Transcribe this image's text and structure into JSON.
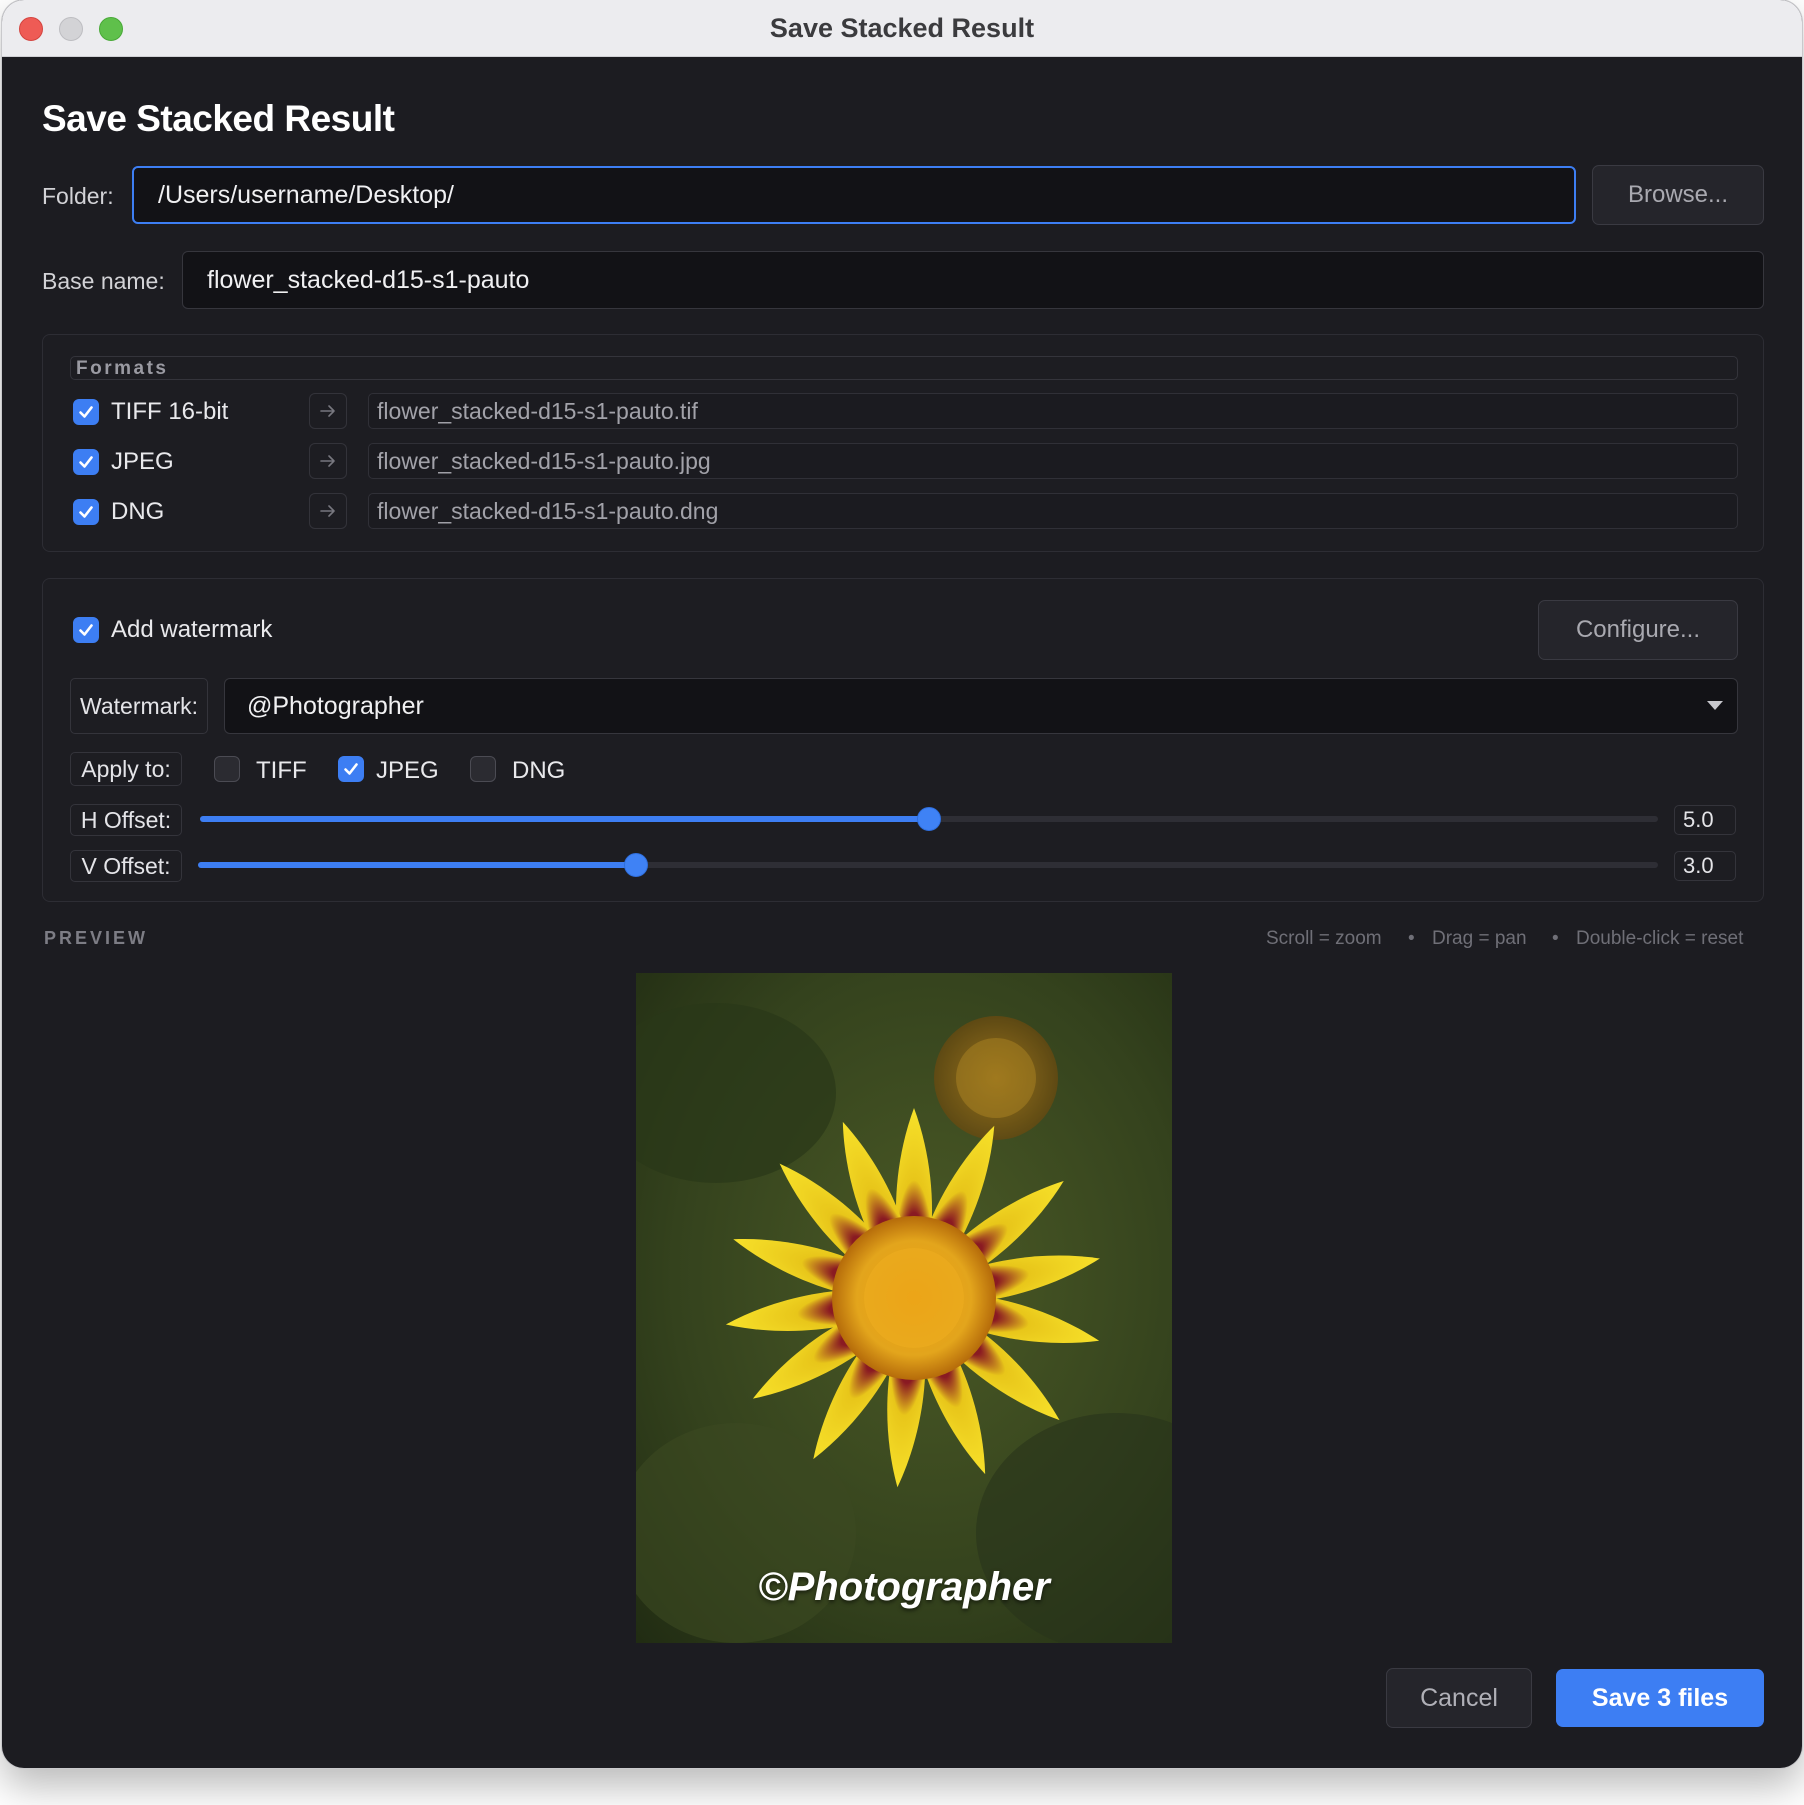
{
  "window": {
    "title": "Save Stacked Result"
  },
  "dialog": {
    "heading": "Save Stacked Result",
    "folder": {
      "label": "Folder:",
      "value": "/Users/username/Desktop/"
    },
    "browse_label": "Browse...",
    "basename": {
      "label": "Base name:",
      "value": "flower_stacked-d15-s1-pauto"
    }
  },
  "formats": {
    "legend": "Formats",
    "items": [
      {
        "label": "TIFF 16-bit",
        "checked": true,
        "filename": "flower_stacked-d15-s1-pauto.tif"
      },
      {
        "label": "JPEG",
        "checked": true,
        "filename": "flower_stacked-d15-s1-pauto.jpg"
      },
      {
        "label": "DNG",
        "checked": true,
        "filename": "flower_stacked-d15-s1-pauto.dng"
      }
    ]
  },
  "watermark": {
    "add_label": "Add watermark",
    "add_checked": true,
    "configure_label": "Configure...",
    "select_label": "Watermark:",
    "selected": "@Photographer",
    "apply_label": "Apply to:",
    "apply": [
      {
        "label": "TIFF",
        "checked": false
      },
      {
        "label": "JPEG",
        "checked": true
      },
      {
        "label": "DNG",
        "checked": false
      }
    ],
    "h_offset": {
      "label": "H Offset:",
      "value": "5.0",
      "fraction": 0.5
    },
    "v_offset": {
      "label": "V Offset:",
      "value": "3.0",
      "fraction": 0.3
    }
  },
  "preview": {
    "label": "PREVIEW",
    "hints": [
      "Scroll = zoom",
      "Drag = pan",
      "Double-click = reset"
    ],
    "hint_separator": "•",
    "watermark_text": "©Photographer"
  },
  "actions": {
    "cancel_label": "Cancel",
    "save_label": "Save 3 files"
  },
  "colors": {
    "accent": "#3d7ef3",
    "background": "#1c1c21"
  }
}
